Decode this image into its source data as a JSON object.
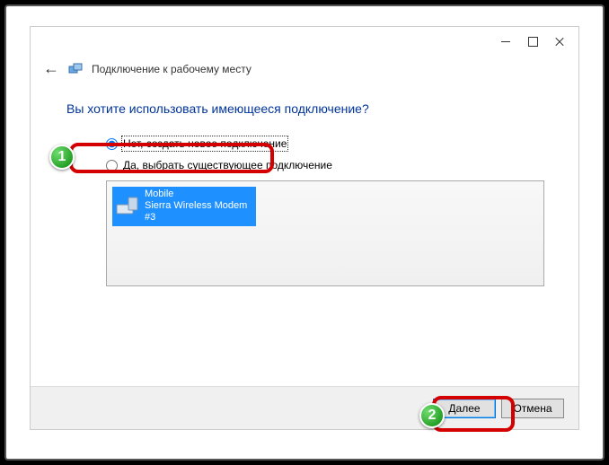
{
  "header": {
    "title": "Подключение к рабочему месту"
  },
  "content": {
    "question": "Вы хотите использовать имеющееся подключение?",
    "radio_new": "Нет, создать новое подключение",
    "radio_existing": "Да, выбрать существующее подключение"
  },
  "connection": {
    "name": "Mobile",
    "device": "Sierra Wireless Modem #3"
  },
  "footer": {
    "next": "Далее",
    "cancel": "Отмена"
  },
  "annotations": {
    "badge1": "1",
    "badge2": "2"
  }
}
